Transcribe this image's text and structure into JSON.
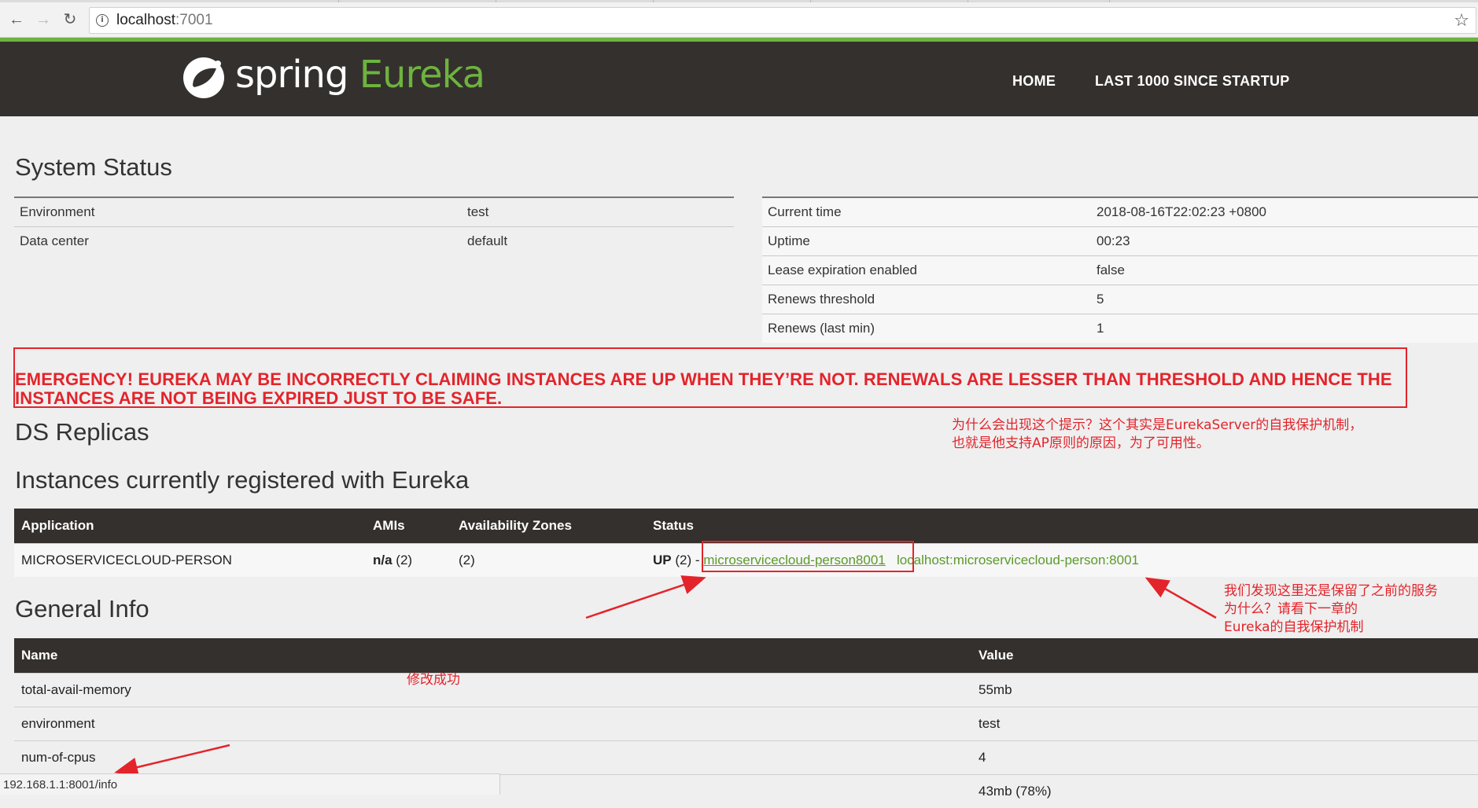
{
  "browser": {
    "url_host": "localhost",
    "url_port": ":7001"
  },
  "navbar": {
    "brand_spring": "spring",
    "brand_eureka": "Eureka",
    "home": "HOME",
    "last1000": "LAST 1000 SINCE STARTUP"
  },
  "system_status": {
    "title": "System Status",
    "left": [
      {
        "k": "Environment",
        "v": "test"
      },
      {
        "k": "Data center",
        "v": "default"
      }
    ],
    "right": [
      {
        "k": "Current time",
        "v": "2018-08-16T22:02:23 +0800"
      },
      {
        "k": "Uptime",
        "v": "00:23"
      },
      {
        "k": "Lease expiration enabled",
        "v": "false"
      },
      {
        "k": "Renews threshold",
        "v": "5"
      },
      {
        "k": "Renews (last min)",
        "v": "1"
      }
    ]
  },
  "emergency": "EMERGENCY! EUREKA MAY BE INCORRECTLY CLAIMING INSTANCES ARE UP WHEN THEY’RE NOT. RENEWALS ARE LESSER THAN THRESHOLD AND HENCE THE INSTANCES ARE NOT BEING EXPIRED JUST TO BE SAFE.",
  "ds_replicas": "DS Replicas",
  "instances": {
    "title": "Instances currently registered with Eureka",
    "headers": [
      "Application",
      "AMIs",
      "Availability Zones",
      "Status"
    ],
    "row": {
      "application": "MICROSERVICECLOUD-PERSON",
      "amis_strong": "n/a",
      "amis_count": " (2)",
      "zones": "(2)",
      "status_strong": "UP",
      "status_count": " (2) -",
      "link1": "microservicecloud-person8001",
      "link2": "localhost:microservicecloud-person:8001"
    }
  },
  "general_info": {
    "title": "General Info",
    "headers": [
      "Name",
      "Value"
    ],
    "rows": [
      {
        "name": "total-avail-memory",
        "value": "55mb"
      },
      {
        "name": "environment",
        "value": "test"
      },
      {
        "name": "num-of-cpus",
        "value": "4"
      },
      {
        "name": "",
        "value": "43mb (78%)"
      }
    ]
  },
  "annotations": {
    "note1_line1": "为什么会出现这个提示？这个其实是EurekaServer的自我保护机制，",
    "note1_line2": "也就是他支持AP原则的原因，为了可用性。",
    "note2_line1": "我们发现这里还是保留了之前的服务",
    "note2_line2": "为什么？请看下一章的",
    "note2_line3": "Eureka的自我保护机制",
    "note3": "修改成功",
    "color": "#e3242b"
  },
  "statusbar": "192.168.1.1:8001/info"
}
